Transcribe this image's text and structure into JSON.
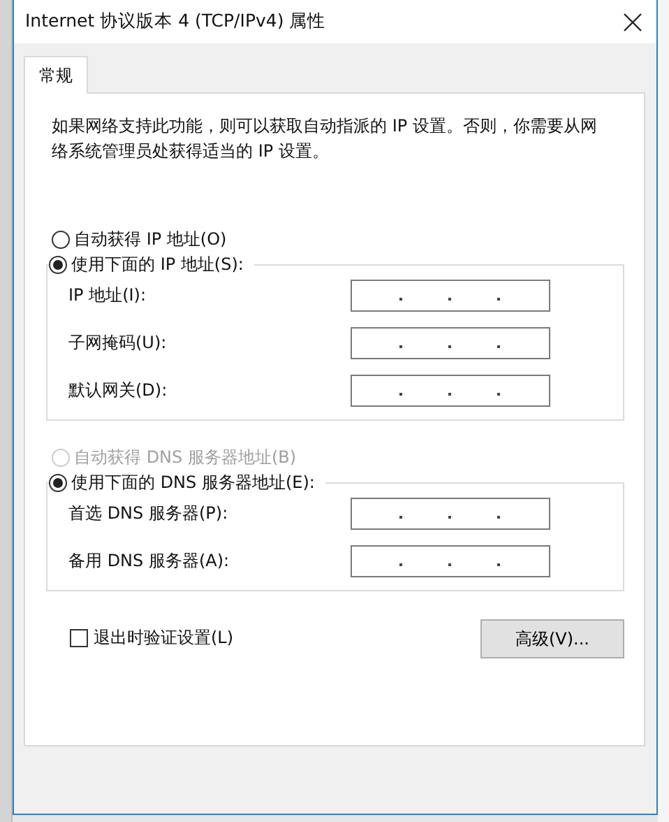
{
  "window": {
    "title": "Internet 协议版本 4 (TCP/IPv4) 属性"
  },
  "tabs": [
    {
      "label": "常规",
      "selected": true
    }
  ],
  "description": "如果网络支持此功能，则可以获取自动指派的 IP 设置。否则，你需要从网络系统管理员处获得适当的 IP 设置。",
  "sections": [
    {
      "auto_option": {
        "label": "自动获得 IP 地址(O)",
        "selected": false,
        "disabled": false
      },
      "manual_option": {
        "label": "使用下面的 IP 地址(S):",
        "selected": true,
        "disabled": false
      },
      "fields": [
        {
          "label": "IP 地址(I):"
        },
        {
          "label": "子网掩码(U):"
        },
        {
          "label": "默认网关(D):"
        }
      ]
    },
    {
      "auto_option": {
        "label": "自动获得 DNS 服务器地址(B)",
        "selected": false,
        "disabled": true
      },
      "manual_option": {
        "label": "使用下面的 DNS 服务器地址(E):",
        "selected": true,
        "disabled": false
      },
      "fields": [
        {
          "label": "首选 DNS 服务器(P):"
        },
        {
          "label": "备用 DNS 服务器(A):"
        }
      ]
    }
  ],
  "validate_checkbox": {
    "label": "退出时验证设置(L)",
    "checked": false
  },
  "advanced_button": {
    "label": "高级(V)..."
  }
}
